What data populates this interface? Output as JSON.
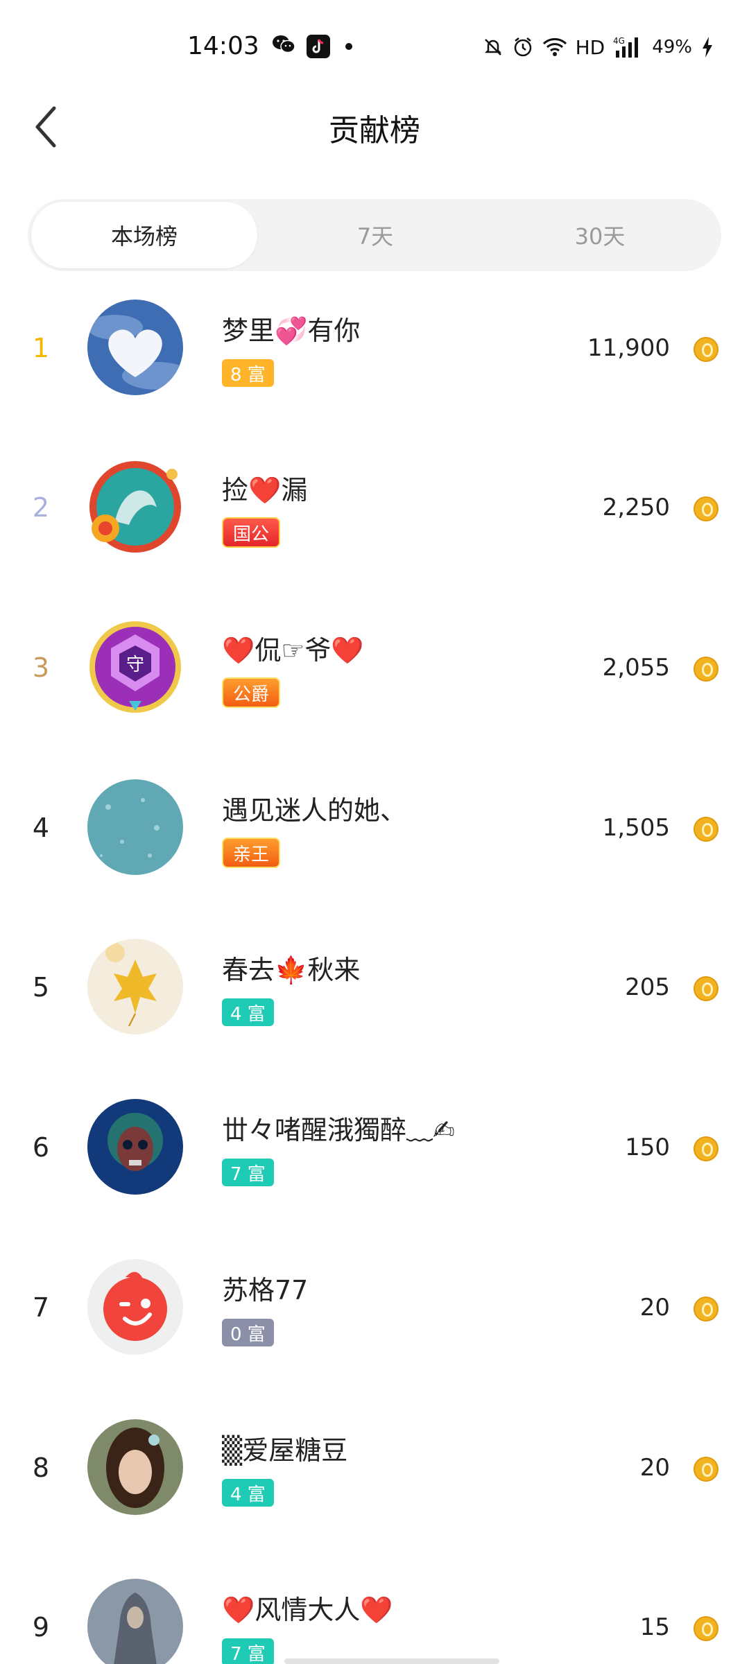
{
  "status_bar": {
    "time": "14:03",
    "network": "HD",
    "signal_type": "4G",
    "battery": "49%",
    "icons": [
      "wechat-icon",
      "tiktok-icon",
      "notification-dot",
      "mute-icon",
      "alarm-icon",
      "wifi-icon",
      "signal-icon",
      "charging-icon"
    ]
  },
  "header": {
    "title": "贡献榜",
    "back_icon": "chevron-left-icon"
  },
  "tabs": [
    {
      "label": "本场榜",
      "active": true
    },
    {
      "label": "7天",
      "active": false
    },
    {
      "label": "30天",
      "active": false
    }
  ],
  "rank_colors": {
    "1": "#f5b800",
    "2": "#a9b0dc",
    "3": "#c89a5a",
    "default": "#222222"
  },
  "rows": [
    {
      "rank": "1",
      "name": "梦里💞有你",
      "badge": "8 富",
      "badge_style": "gold",
      "score": "11,900"
    },
    {
      "rank": "2",
      "name": "捡❤️漏",
      "badge": "国公",
      "badge_style": "red",
      "score": "2,250"
    },
    {
      "rank": "3",
      "name": "❤️侃☞爷❤️",
      "badge": "公爵",
      "badge_style": "orange",
      "score": "2,055"
    },
    {
      "rank": "4",
      "name": "遇见迷人的她、",
      "badge": "亲王",
      "badge_style": "orange",
      "score": "1,505"
    },
    {
      "rank": "5",
      "name": "春去🍁秋来",
      "badge": "4 富",
      "badge_style": "teal",
      "score": "205"
    },
    {
      "rank": "6",
      "name": "丗々啫醒涐獨醉﹏✍",
      "badge": "7 富",
      "badge_style": "teal",
      "score": "150"
    },
    {
      "rank": "7",
      "name": "苏格77",
      "badge": "0 富",
      "badge_style": "gray",
      "score": "20"
    },
    {
      "rank": "8",
      "name": "▒爱屋糖豆",
      "badge": "4 富",
      "badge_style": "teal",
      "score": "20"
    },
    {
      "rank": "9",
      "name": "❤️风情大人❤️",
      "badge": "7 富",
      "badge_style": "teal",
      "score": "15"
    }
  ],
  "coin_icon": "gold-coin-icon"
}
